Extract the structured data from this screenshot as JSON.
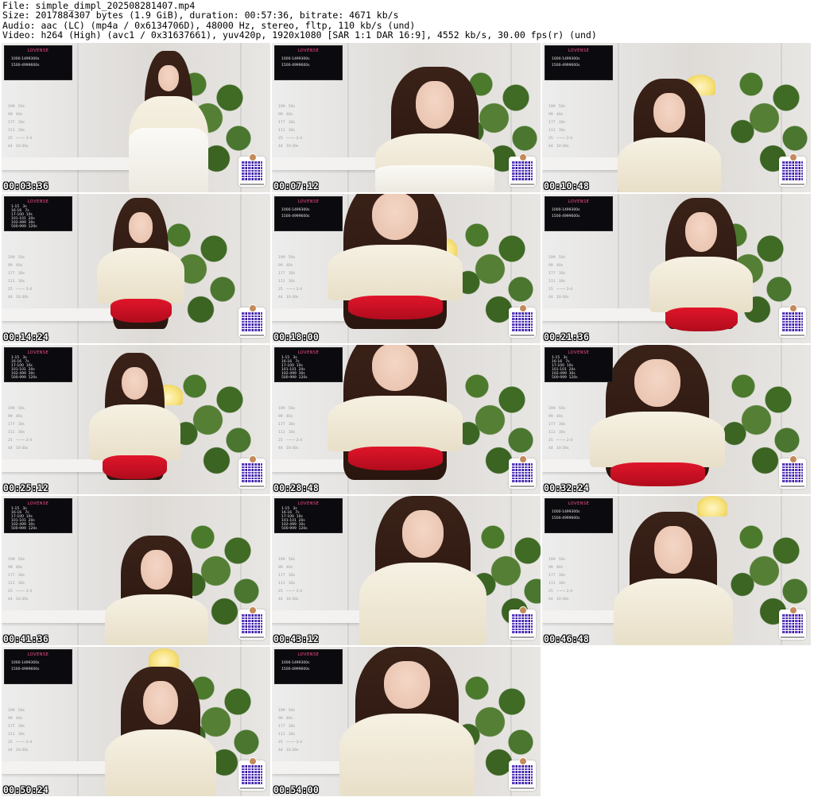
{
  "header": {
    "line1": "File: simple_dimpl_202508281407.mp4",
    "line2": "Size: 2017884307 bytes (1.9 GiB), duration: 00:57:36, bitrate: 4671 kb/s",
    "line3": "Audio: aac (LC) (mp4a / 0x6134706D), 48000 Hz, stereo, fltp, 110 kb/s (und)",
    "line4": "Video: h264 (High) (avc1 / 0x31637661), yuv420p, 1920x1080 [SAR 1:1 DAR 16:9], 4552 kb/s, 30.00 fps(r) (und)"
  },
  "overlay": {
    "brand": "LOVENSE",
    "tips": [
      "1000-1499300s",
      "1500-4999600s"
    ],
    "levels": [
      "1-15   3s",
      "16-16   7s",
      "17-100  10s",
      "101-101  20s",
      "102-499  30s",
      "500-999  120s"
    ],
    "dim": [
      "199   50s",
      "99   40s",
      "177   30s",
      "111   30s",
      "25   ~~~ 2-4",
      "44   10-30s"
    ]
  },
  "thumbnails": [
    {
      "time": "00:03:36"
    },
    {
      "time": "00:07:12"
    },
    {
      "time": "00:10:48"
    },
    {
      "time": "00:14:24"
    },
    {
      "time": "00:18:00"
    },
    {
      "time": "00:21:36"
    },
    {
      "time": "00:25:12"
    },
    {
      "time": "00:28:48"
    },
    {
      "time": "00:32:24"
    },
    {
      "time": "00:41:36"
    },
    {
      "time": "00:43:12"
    },
    {
      "time": "00:46:48"
    },
    {
      "time": "00:50:24"
    },
    {
      "time": "00:54:00"
    }
  ]
}
